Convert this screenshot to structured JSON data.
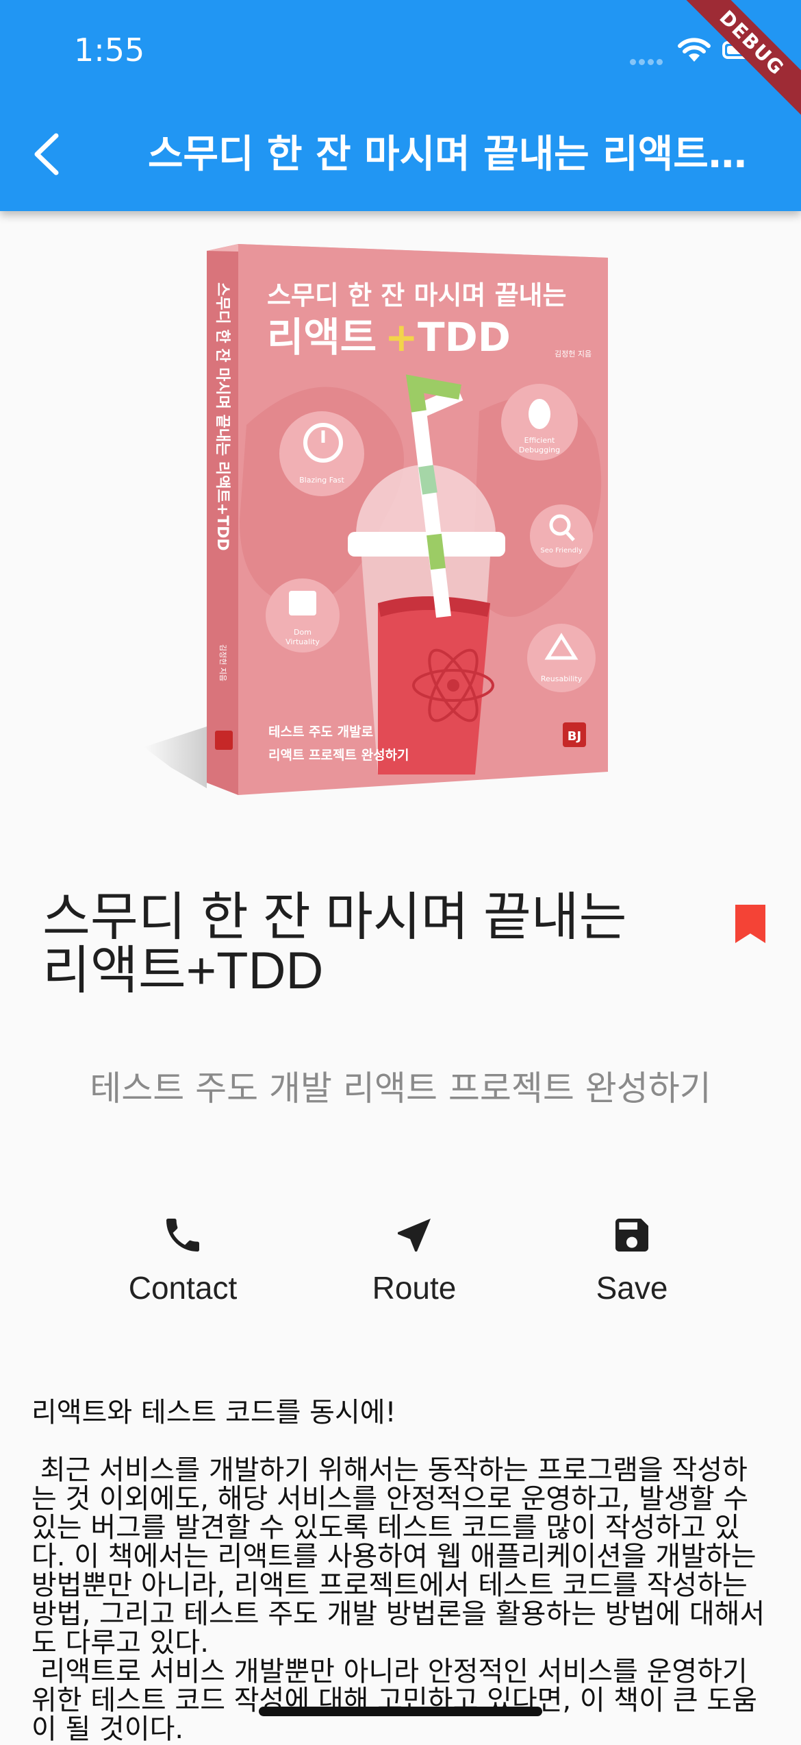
{
  "status_bar": {
    "time": "1:55"
  },
  "debug_banner": "DEBUG",
  "app_bar": {
    "title": "스무디 한 잔 마시며 끝내는 리액트+TDD"
  },
  "cover": {
    "title_line1": "스무디 한 잔 마시며 끝내는",
    "title_line2_a": "리액트",
    "title_line2_b": "TDD",
    "author": "김정헌 지음",
    "spine_text": "스무디 한 잔 마시며 끝내는 리액트+TDD",
    "spine_author": "김정헌 지음",
    "badge_blazing": "Blazing Fast",
    "badge_debugging_1": "Efficient",
    "badge_debugging_2": "Debugging",
    "badge_seo": "Seo Friendly",
    "badge_dom_1": "Dom",
    "badge_dom_2": "Virtuality",
    "badge_reusability": "Reusability",
    "bottom_line1": "테스트 주도 개발로",
    "bottom_line2": "리액트 프로젝트 완성하기",
    "publisher": "BJ",
    "colors": {
      "cover": "#e8959a",
      "dark": "#d9747b",
      "accent": "#f3d44a"
    }
  },
  "book": {
    "title": "스무디 한 잔 마시며 끝내는 리액트+TDD",
    "subtitle": "테스트 주도 개발 리액트 프로젝트 완성하기",
    "bookmark_color": "#f44336"
  },
  "actions": [
    {
      "label": "Contact",
      "icon": "phone-icon"
    },
    {
      "label": "Route",
      "icon": "navigation-icon"
    },
    {
      "label": "Save",
      "icon": "save-icon"
    }
  ],
  "description": "리액트와 테스트 코드를 동시에!\n\n 최근 서비스를 개발하기 위해서는 동작하는 프로그램을 작성하는 것 이외에도, 해당 서비스를 안정적으로 운영하고, 발생할 수 있는 버그를 발견할 수 있도록 테스트 코드를 많이 작성하고 있다. 이 책에서는 리액트를 사용하여 웹 애플리케이션을 개발하는 방법뿐만 아니라, 리액트 프로젝트에서 테스트 코드를 작성하는 방법, 그리고 테스트 주도 개발 방법론을 활용하는 방법에 대해서도 다루고 있다.\n 리액트로 서비스 개발뿐만 아니라 안정적인 서비스를 운영하기 위한 테스트 코드 작성에 대해 고민하고 있다면, 이 책이 큰 도움이 될 것이다."
}
